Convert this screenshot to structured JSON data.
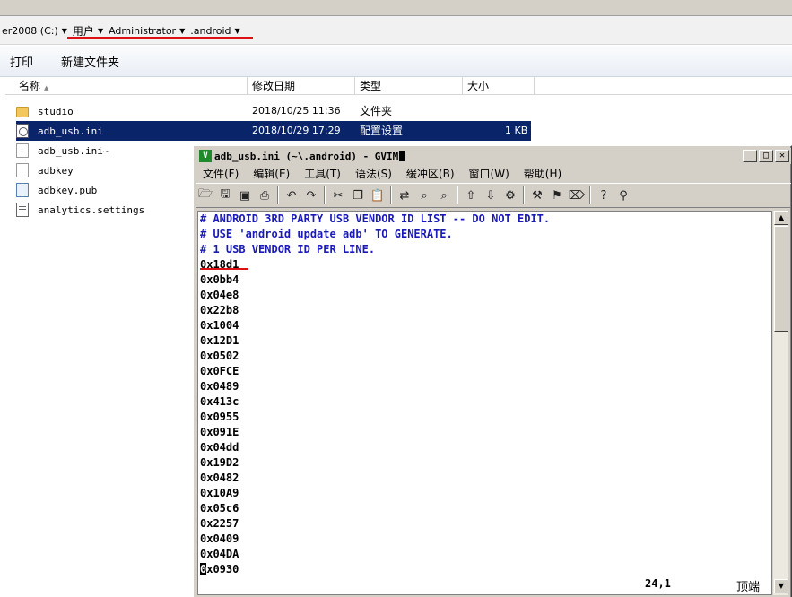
{
  "explorer": {
    "breadcrumb": [
      {
        "label": "er2008 (C:)"
      },
      {
        "label": "用户"
      },
      {
        "label": "Administrator"
      },
      {
        "label": ".android"
      }
    ],
    "toolbar": {
      "print": "打印",
      "new_folder": "新建文件夹"
    },
    "columns": {
      "name": "名称",
      "modified": "修改日期",
      "type": "类型",
      "size": "大小"
    },
    "files": [
      {
        "name": "studio",
        "modified": "2018/10/25 11:36",
        "type": "文件夹",
        "size": "",
        "icon": "folder-icon"
      },
      {
        "name": "adb_usb.ini",
        "modified": "2018/10/29 17:29",
        "type": "配置设置",
        "size": "1 KB",
        "icon": "ini-file-icon",
        "selected": true
      },
      {
        "name": "adb_usb.ini~",
        "modified": "",
        "type": "",
        "size": "",
        "icon": "file-icon"
      },
      {
        "name": "adbkey",
        "modified": "",
        "type": "",
        "size": "",
        "icon": "file-icon"
      },
      {
        "name": "adbkey.pub",
        "modified": "",
        "type": "",
        "size": "",
        "icon": "pub-file-icon"
      },
      {
        "name": "analytics.settings",
        "modified": "",
        "type": "",
        "size": "",
        "icon": "settings-file-icon"
      }
    ]
  },
  "gvim": {
    "title": "adb_usb.ini (~\\.android) - GVIM",
    "menu": [
      "文件(F)",
      "编辑(E)",
      "工具(T)",
      "语法(S)",
      "缓冲区(B)",
      "窗口(W)",
      "帮助(H)"
    ],
    "lines": [
      {
        "text": "# ANDROID 3RD PARTY USB VENDOR ID LIST -- DO NOT EDIT.",
        "comment": true
      },
      {
        "text": "# USE 'android update adb' TO GENERATE.",
        "comment": true
      },
      {
        "text": "# 1 USB VENDOR ID PER LINE.",
        "comment": true
      },
      {
        "text": "0x18d1"
      },
      {
        "text": "0x0bb4"
      },
      {
        "text": "0x04e8"
      },
      {
        "text": "0x22b8"
      },
      {
        "text": "0x1004"
      },
      {
        "text": "0x12D1"
      },
      {
        "text": "0x0502"
      },
      {
        "text": "0x0FCE"
      },
      {
        "text": "0x0489"
      },
      {
        "text": "0x413c"
      },
      {
        "text": "0x0955"
      },
      {
        "text": "0x091E"
      },
      {
        "text": "0x04dd"
      },
      {
        "text": "0x19D2"
      },
      {
        "text": "0x0482"
      },
      {
        "text": "0x10A9"
      },
      {
        "text": "0x05c6"
      },
      {
        "text": "0x2257"
      },
      {
        "text": "0x0409"
      },
      {
        "text": "0x04DA"
      },
      {
        "text": "0x0930"
      }
    ],
    "cursor_line": 24,
    "status_position": "24,1",
    "status_scroll": "顶端"
  }
}
